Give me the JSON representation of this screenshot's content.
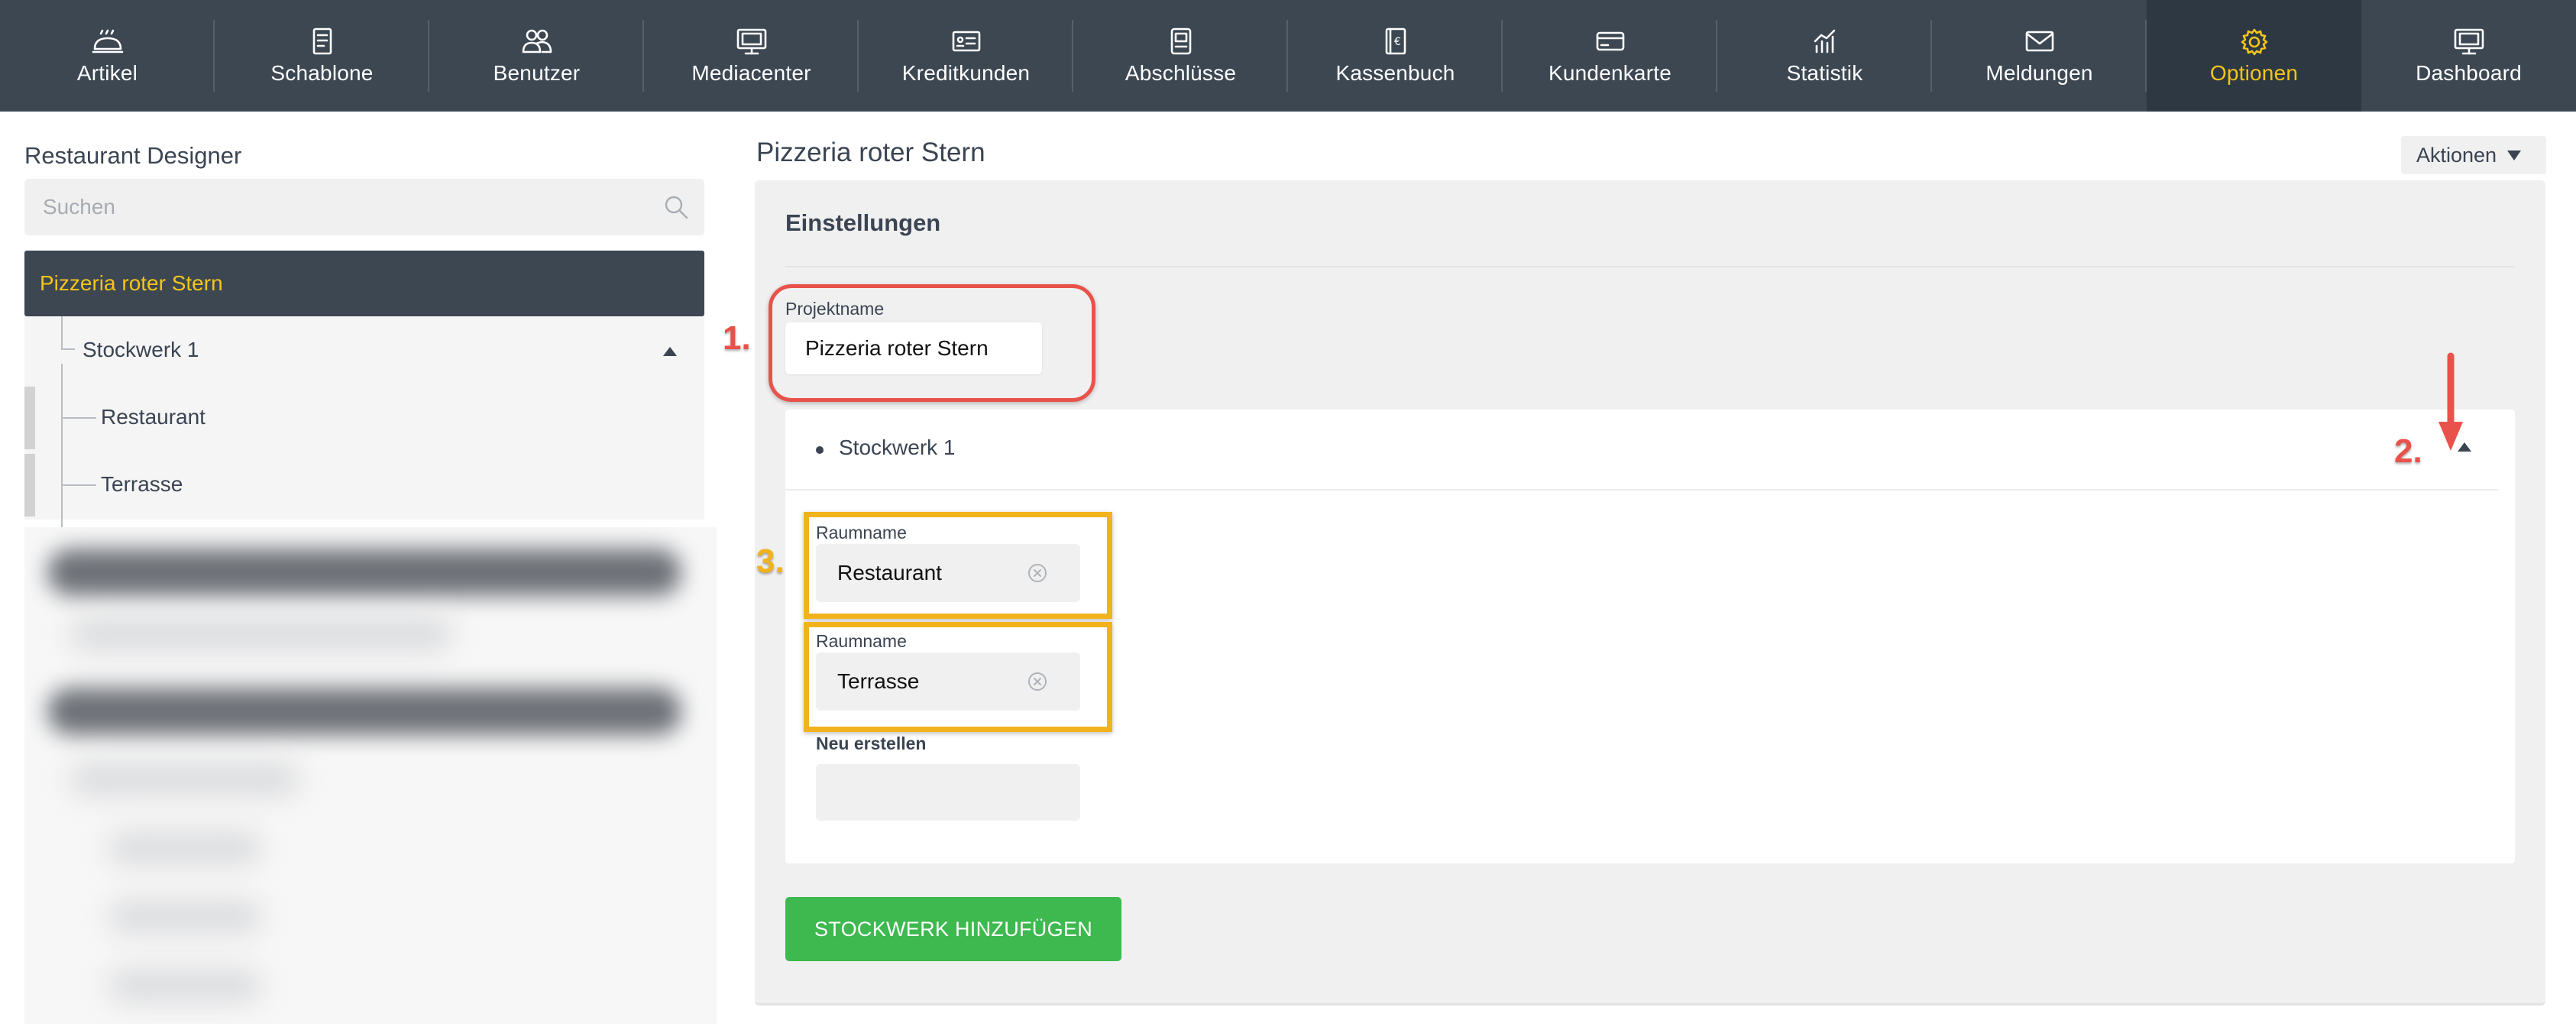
{
  "nav": {
    "items": [
      {
        "label": "Artikel",
        "icon": "bread-icon"
      },
      {
        "label": "Schablone",
        "icon": "template-icon"
      },
      {
        "label": "Benutzer",
        "icon": "users-icon"
      },
      {
        "label": "Mediacenter",
        "icon": "monitor-icon"
      },
      {
        "label": "Kreditkunden",
        "icon": "id-card-icon"
      },
      {
        "label": "Abschlüsse",
        "icon": "closing-icon"
      },
      {
        "label": "Kassenbuch",
        "icon": "cashbook-icon"
      },
      {
        "label": "Kundenkarte",
        "icon": "card-icon"
      },
      {
        "label": "Statistik",
        "icon": "statistics-icon"
      },
      {
        "label": "Meldungen",
        "icon": "envelope-icon"
      },
      {
        "label": "Optionen",
        "icon": "gear-icon",
        "active": true
      },
      {
        "label": "Dashboard",
        "icon": "dashboard-icon"
      }
    ],
    "active_color": "#f5c518",
    "background": "#3c4752"
  },
  "sidebar": {
    "title": "Restaurant Designer",
    "search_placeholder": "Suchen",
    "project": "Pizzeria roter Stern",
    "floor": "Stockwerk 1",
    "rooms": [
      "Restaurant",
      "Terrasse"
    ]
  },
  "main": {
    "title": "Pizzeria roter Stern",
    "actions_label": "Aktionen",
    "settings_title": "Einstellungen",
    "project_label": "Projektname",
    "project_value": "Pizzeria roter Stern",
    "floor_name": "Stockwerk 1",
    "room_label": "Raumname",
    "rooms": [
      "Restaurant",
      "Terrasse"
    ],
    "new_label": "Neu erstellen",
    "add_floor_button": "STOCKWERK HINZUFÜGEN",
    "button_color": "#3db94f"
  },
  "annotations": {
    "step1": "1.",
    "step2": "2.",
    "step3": "3.",
    "red": "#e8524a",
    "yellow": "#f2b21b"
  }
}
